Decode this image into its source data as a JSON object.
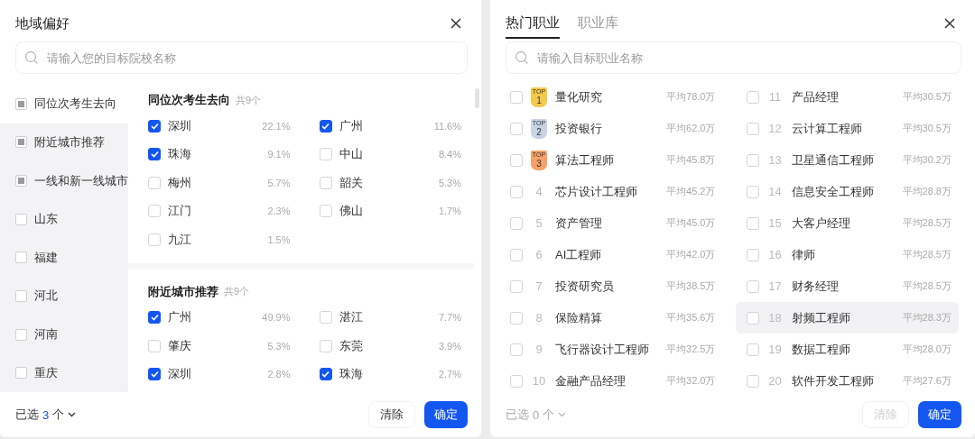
{
  "region_panel": {
    "title": "地域偏好",
    "search": {
      "placeholder": "请输入您的目标院校名称"
    },
    "sidebar": [
      {
        "label": "同位次考生去向",
        "selected": true,
        "partial": true
      },
      {
        "label": "附近城市推荐",
        "selected": false,
        "partial": true
      },
      {
        "label": "一线和新一线城市",
        "selected": false,
        "partial": true
      },
      {
        "label": "山东",
        "selected": false,
        "partial": false
      },
      {
        "label": "福建",
        "selected": false,
        "partial": false
      },
      {
        "label": "河北",
        "selected": false,
        "partial": false
      },
      {
        "label": "河南",
        "selected": false,
        "partial": false
      },
      {
        "label": "重庆",
        "selected": false,
        "partial": false
      }
    ],
    "sections": [
      {
        "title": "同位次考生去向",
        "count": "共9个",
        "items": [
          {
            "name": "深圳",
            "share": "22.1%",
            "checked": true
          },
          {
            "name": "广州",
            "share": "11.6%",
            "checked": true
          },
          {
            "name": "珠海",
            "share": "9.1%",
            "checked": true
          },
          {
            "name": "中山",
            "share": "8.4%",
            "checked": false
          },
          {
            "name": "梅州",
            "share": "5.7%",
            "checked": false
          },
          {
            "name": "韶关",
            "share": "5.3%",
            "checked": false
          },
          {
            "name": "江门",
            "share": "2.3%",
            "checked": false
          },
          {
            "name": "佛山",
            "share": "1.7%",
            "checked": false
          },
          {
            "name": "九江",
            "share": "1.5%",
            "checked": false
          }
        ]
      },
      {
        "title": "附近城市推荐",
        "count": "共9个",
        "items": [
          {
            "name": "广州",
            "share": "49.9%",
            "checked": true
          },
          {
            "name": "湛江",
            "share": "7.7%",
            "checked": false
          },
          {
            "name": "肇庆",
            "share": "5.3%",
            "checked": false
          },
          {
            "name": "东莞",
            "share": "3.9%",
            "checked": false
          },
          {
            "name": "深圳",
            "share": "2.8%",
            "checked": true
          },
          {
            "name": "珠海",
            "share": "2.7%",
            "checked": true
          }
        ]
      }
    ],
    "footer": {
      "selected_label": "已选",
      "selected_count": "3",
      "selected_unit": "个",
      "disabled": false,
      "clear": "清除",
      "confirm": "确定"
    }
  },
  "career_panel": {
    "tabs": [
      {
        "label": "热门职业",
        "selected": true
      },
      {
        "label": "职业库",
        "selected": false
      }
    ],
    "search": {
      "placeholder": "请输入目标职业名称"
    },
    "jobs": [
      {
        "kind": "medal",
        "rank": "1",
        "badge": "TOP",
        "color": "#f6c94a",
        "name": "量化研究",
        "salary": "平均78.0万",
        "checked": false,
        "hovered": false
      },
      {
        "kind": "medal",
        "rank": "2",
        "badge": "TOP",
        "color": "#c9d3e3",
        "name": "投资银行",
        "salary": "平均62.0万",
        "checked": false,
        "hovered": false
      },
      {
        "kind": "medal",
        "rank": "3",
        "badge": "TOP",
        "color": "#f7a26a",
        "name": "算法工程师",
        "salary": "平均45.8万",
        "checked": false,
        "hovered": false
      },
      {
        "kind": "plain",
        "rank": "4",
        "name": "芯片设计工程师",
        "salary": "平均45.2万",
        "checked": false,
        "hovered": false
      },
      {
        "kind": "plain",
        "rank": "5",
        "name": "资产管理",
        "salary": "平均45.0万",
        "checked": false,
        "hovered": false
      },
      {
        "kind": "plain",
        "rank": "6",
        "name": "AI工程师",
        "salary": "平均42.0万",
        "checked": false,
        "hovered": false
      },
      {
        "kind": "plain",
        "rank": "7",
        "name": "投资研究员",
        "salary": "平均38.5万",
        "checked": false,
        "hovered": false
      },
      {
        "kind": "plain",
        "rank": "8",
        "name": "保险精算",
        "salary": "平均35.6万",
        "checked": false,
        "hovered": false
      },
      {
        "kind": "plain",
        "rank": "9",
        "name": "飞行器设计工程师",
        "salary": "平均32.5万",
        "checked": false,
        "hovered": false
      },
      {
        "kind": "plain",
        "rank": "10",
        "name": "金融产品经理",
        "salary": "平均32.0万",
        "checked": false,
        "hovered": false
      },
      {
        "kind": "plain",
        "rank": "11",
        "name": "产品经理",
        "salary": "平均30.5万",
        "checked": false,
        "hovered": false
      },
      {
        "kind": "plain",
        "rank": "12",
        "name": "云计算工程师",
        "salary": "平均30.5万",
        "checked": false,
        "hovered": false
      },
      {
        "kind": "plain",
        "rank": "13",
        "name": "卫星通信工程师",
        "salary": "平均30.2万",
        "checked": false,
        "hovered": false
      },
      {
        "kind": "plain",
        "rank": "14",
        "name": "信息安全工程师",
        "salary": "平均28.8万",
        "checked": false,
        "hovered": false
      },
      {
        "kind": "plain",
        "rank": "15",
        "name": "大客户经理",
        "salary": "平均28.5万",
        "checked": false,
        "hovered": false
      },
      {
        "kind": "plain",
        "rank": "16",
        "name": "律师",
        "salary": "平均28.5万",
        "checked": false,
        "hovered": false
      },
      {
        "kind": "plain",
        "rank": "17",
        "name": "财务经理",
        "salary": "平均28.5万",
        "checked": false,
        "hovered": false
      },
      {
        "kind": "plain",
        "rank": "18",
        "name": "射频工程师",
        "salary": "平均28.3万",
        "checked": false,
        "hovered": true
      },
      {
        "kind": "plain",
        "rank": "19",
        "name": "数据工程师",
        "salary": "平均28.0万",
        "checked": false,
        "hovered": false
      },
      {
        "kind": "plain",
        "rank": "20",
        "name": "软件开发工程师",
        "salary": "平均27.6万",
        "checked": false,
        "hovered": false
      }
    ],
    "footer": {
      "selected_label": "已选",
      "selected_count": "0",
      "selected_unit": "个",
      "disabled": true,
      "clear": "清除",
      "confirm": "确定"
    }
  }
}
